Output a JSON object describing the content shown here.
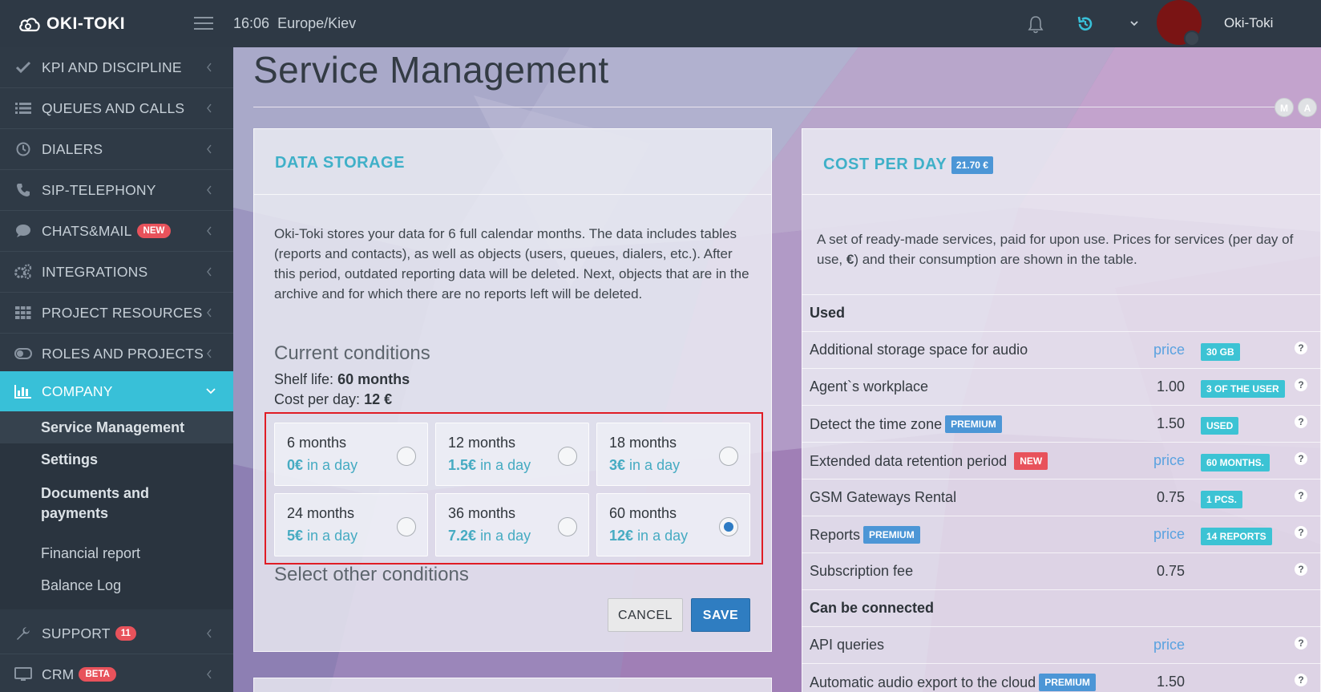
{
  "header": {
    "logo_text": "OKI-TOKI",
    "time": "16:06",
    "timezone": "Europe/Kiev",
    "username": "Oki-Toki"
  },
  "sidebar": {
    "items": [
      {
        "label": "KPI AND DISCIPLINE",
        "icon": "check-icon"
      },
      {
        "label": "QUEUES AND CALLS",
        "icon": "list-icon"
      },
      {
        "label": "DIALERS",
        "icon": "clock-icon"
      },
      {
        "label": "SIP-TELEPHONY",
        "icon": "phone-icon"
      },
      {
        "label": "CHATS&MAIL",
        "icon": "chat-icon",
        "badge": "NEW"
      },
      {
        "label": "INTEGRATIONS",
        "icon": "gears-icon"
      },
      {
        "label": "PROJECT RESOURCES",
        "icon": "grid-icon"
      },
      {
        "label": "ROLES AND PROJECTS",
        "icon": "toggle-icon"
      },
      {
        "label": "COMPANY",
        "icon": "bar-chart-icon"
      },
      {
        "label": "SUPPORT",
        "icon": "wrench-icon",
        "badge": "11"
      },
      {
        "label": "CRM",
        "icon": "monitor-icon",
        "badge": "BETA"
      }
    ],
    "submenu": [
      {
        "label": "Service Management"
      },
      {
        "label": "Settings"
      },
      {
        "label": "Documents and payments"
      },
      {
        "label": "Financial report"
      },
      {
        "label": "Balance Log"
      }
    ]
  },
  "page": {
    "title": "Service Management",
    "circle_buttons": [
      "M",
      "A"
    ]
  },
  "data_storage": {
    "title": "DATA STORAGE",
    "description": "Oki-Toki stores your data for 6 full calendar months. The data includes tables (reports and contacts), as well as objects (users, queues, dialers, etc.). After this period, outdated reporting data will be deleted. Next, objects that are in the archive and for which there are no reports left will be deleted.",
    "current_conditions_label": "Current conditions",
    "shelf_life_label": "Shelf life:",
    "shelf_life_value": "60 months",
    "cost_per_day_label": "Cost per day:",
    "cost_per_day_value": "12 €",
    "options": [
      {
        "months": "6 months",
        "price": "0€",
        "suffix": "in a day",
        "selected": false
      },
      {
        "months": "12 months",
        "price": "1.5€",
        "suffix": "in a day",
        "selected": false
      },
      {
        "months": "18 months",
        "price": "3€",
        "suffix": "in a day",
        "selected": false
      },
      {
        "months": "24 months",
        "price": "5€",
        "suffix": "in a day",
        "selected": false
      },
      {
        "months": "36 months",
        "price": "7.2€",
        "suffix": "in a day",
        "selected": false
      },
      {
        "months": "60 months",
        "price": "12€",
        "suffix": "in a day",
        "selected": true
      }
    ],
    "select_other_label": "Select other conditions",
    "cancel_label": "CANCEL",
    "save_label": "SAVE"
  },
  "cost_per_day": {
    "title": "COST PER DAY",
    "total_badge": "21.70 €",
    "description_part1": "A set of ready-made services, paid for upon use. Prices for services (per day of use, ",
    "description_bold": "€",
    "description_part2": ") and their consumption are shown in the table.",
    "used_heading": "Used",
    "rows": [
      {
        "name": "Additional storage space for audio",
        "tag": "",
        "value": "price",
        "chip": "30 GB"
      },
      {
        "name": "Agent`s workplace",
        "tag": "",
        "value": "1.00",
        "chip": "3 OF THE USER"
      },
      {
        "name": "Detect the time zone",
        "tag": "PREMIUM",
        "value": "1.50",
        "chip": "USED"
      },
      {
        "name": "Extended data retention period",
        "tag": "NEW",
        "value": "price",
        "chip": "60 MONTHS."
      },
      {
        "name": "GSM Gateways Rental",
        "tag": "",
        "value": "0.75",
        "chip": "1 PCS."
      },
      {
        "name": "Reports",
        "tag": "PREMIUM",
        "value": "price",
        "chip": "14 REPORTS"
      },
      {
        "name": "Subscription fee",
        "tag": "",
        "value": "0.75",
        "chip": ""
      }
    ],
    "connect_heading": "Can be connected",
    "connect_rows": [
      {
        "name": "API queries",
        "tag": "",
        "value": "price",
        "chip": ""
      },
      {
        "name": "Automatic audio export to the cloud",
        "tag": "PREMIUM",
        "value": "1.50",
        "chip": ""
      }
    ],
    "help_symbol": "?"
  },
  "colors": {
    "accent": "#38c0d8",
    "sidebar_bg": "#2f3a46",
    "save_button": "#2f7dc1",
    "highlight_border": "#e01c25"
  }
}
